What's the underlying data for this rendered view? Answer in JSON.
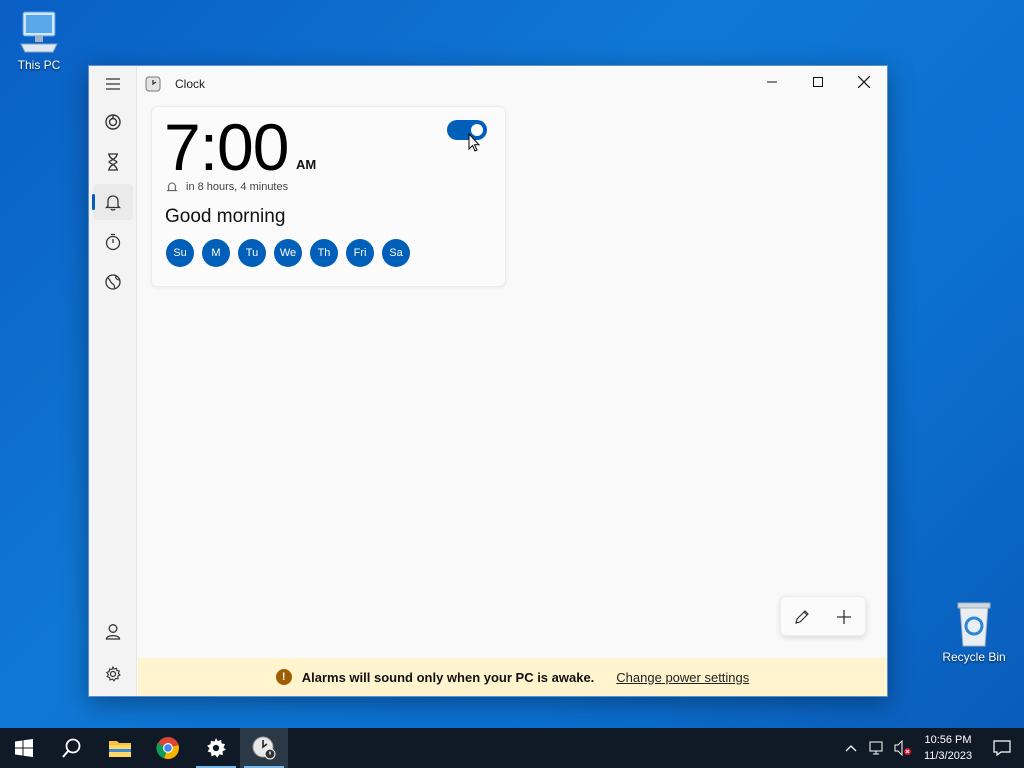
{
  "desktop": {
    "icons": [
      {
        "label": "This PC",
        "icon": "computer-icon"
      },
      {
        "label": "Recycle Bin",
        "icon": "recycle-bin-icon"
      }
    ]
  },
  "window": {
    "title": "Clock",
    "controls": [
      "minimize",
      "maximize",
      "close"
    ]
  },
  "nav": {
    "items": [
      {
        "name": "focus-sessions",
        "icon": "focus-icon",
        "active": false
      },
      {
        "name": "timer",
        "icon": "hourglass-icon",
        "active": false
      },
      {
        "name": "alarm",
        "icon": "bell-icon",
        "active": true
      },
      {
        "name": "stopwatch",
        "icon": "stopwatch-icon",
        "active": false
      },
      {
        "name": "world-clock",
        "icon": "globe-icon",
        "active": false
      }
    ],
    "bottom": [
      {
        "name": "account",
        "icon": "person-icon"
      },
      {
        "name": "settings",
        "icon": "gear-icon"
      }
    ]
  },
  "alarm": {
    "time": "7:00",
    "ampm": "AM",
    "enabled": true,
    "remaining": "in 8 hours, 4 minutes",
    "name": "Good morning",
    "days": [
      "Su",
      "M",
      "Tu",
      "We",
      "Th",
      "Fri",
      "Sa"
    ]
  },
  "infobar": {
    "message": "Alarms will sound only when your PC is awake.",
    "link": "Change power settings"
  },
  "taskbar": {
    "apps": [
      "start",
      "search",
      "file-explorer",
      "chrome",
      "settings",
      "clock"
    ],
    "time": "10:56 PM",
    "date": "11/3/2023"
  },
  "colors": {
    "accent": "#005fb8",
    "infobar": "#fff4ce",
    "taskbar": "#101a27"
  }
}
